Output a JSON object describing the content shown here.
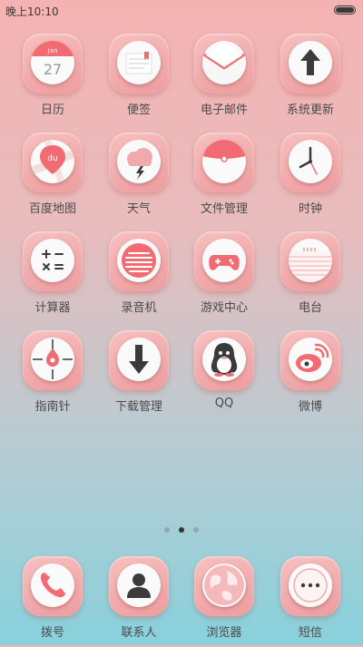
{
  "status": {
    "time": "晚上10:10"
  },
  "colors": {
    "accent": "#f05a63",
    "tile": "#ee9c9e",
    "dark": "#3b3b3b"
  },
  "apps": [
    {
      "label": "日历",
      "icon": "calendar-icon",
      "month": "Jan",
      "day": "27"
    },
    {
      "label": "便签",
      "icon": "notes-icon"
    },
    {
      "label": "电子邮件",
      "icon": "email-icon"
    },
    {
      "label": "系统更新",
      "icon": "update-arrow-icon"
    },
    {
      "label": "百度地图",
      "icon": "baidu-map-icon",
      "logo": "du"
    },
    {
      "label": "天气",
      "icon": "weather-icon"
    },
    {
      "label": "文件管理",
      "icon": "file-manager-icon"
    },
    {
      "label": "时钟",
      "icon": "clock-icon"
    },
    {
      "label": "计算器",
      "icon": "calculator-icon"
    },
    {
      "label": "录音机",
      "icon": "recorder-icon"
    },
    {
      "label": "游戏中心",
      "icon": "gamepad-icon"
    },
    {
      "label": "电台",
      "icon": "radio-icon"
    },
    {
      "label": "指南针",
      "icon": "compass-icon"
    },
    {
      "label": "下载管理",
      "icon": "download-icon"
    },
    {
      "label": "QQ",
      "icon": "qq-penguin-icon"
    },
    {
      "label": "微博",
      "icon": "weibo-icon"
    }
  ],
  "page_indicator": {
    "count": 3,
    "active": 2
  },
  "dock": [
    {
      "label": "拨号",
      "icon": "phone-icon"
    },
    {
      "label": "联系人",
      "icon": "contacts-icon"
    },
    {
      "label": "浏览器",
      "icon": "browser-globe-icon"
    },
    {
      "label": "短信",
      "icon": "messages-icon"
    }
  ]
}
